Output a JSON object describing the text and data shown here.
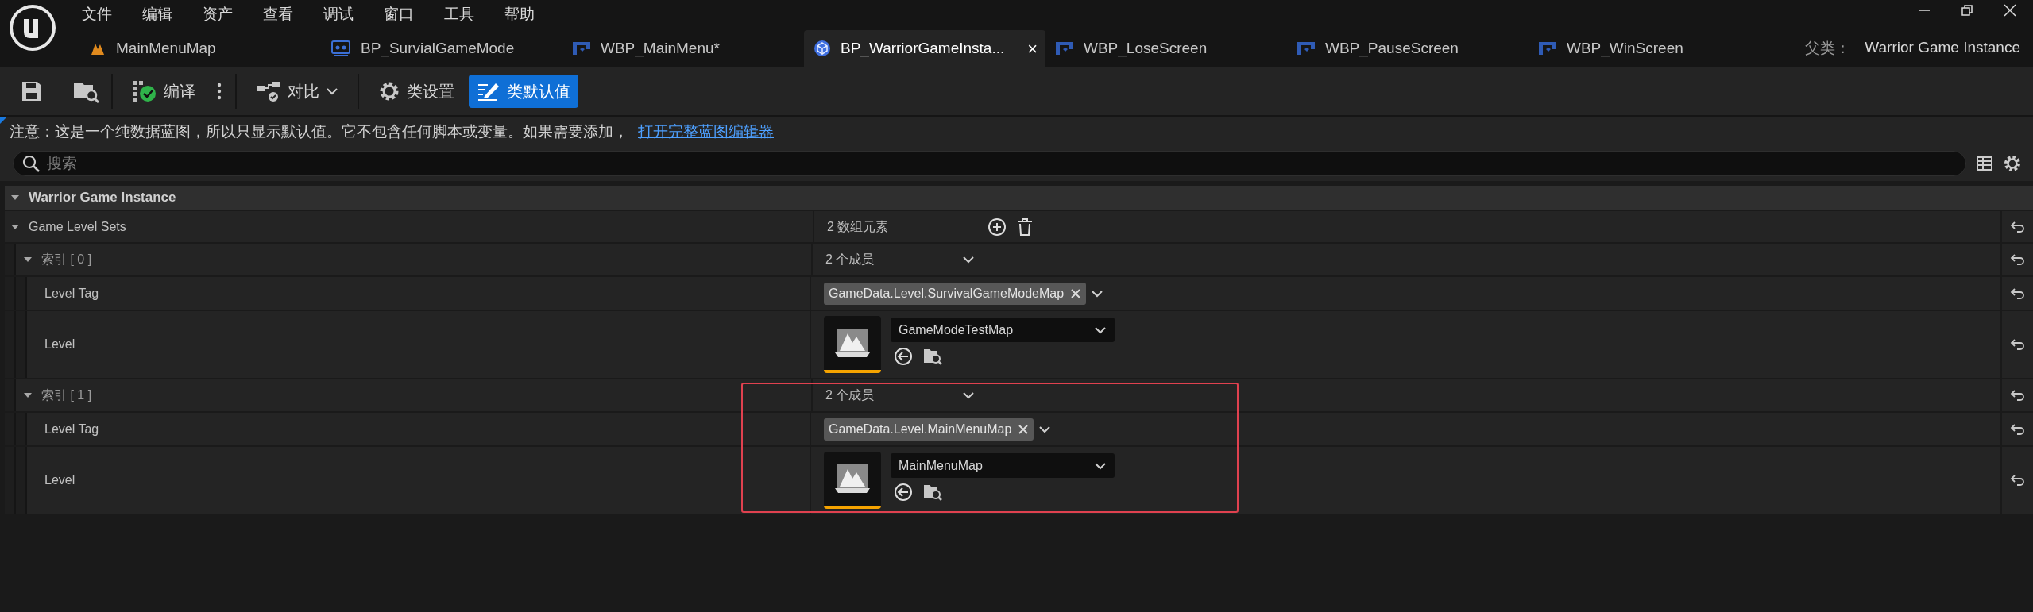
{
  "menu": [
    "文件",
    "编辑",
    "资产",
    "查看",
    "调试",
    "窗口",
    "工具",
    "帮助"
  ],
  "tabs": [
    {
      "label": "MainMenuMap",
      "kind": "level",
      "selected": false
    },
    {
      "label": "BP_SurvialGameMode",
      "kind": "gamemode",
      "selected": false
    },
    {
      "label": "WBP_MainMenu*",
      "kind": "widget",
      "selected": false
    },
    {
      "label": "BP_WarriorGameInsta...",
      "kind": "instance",
      "selected": true,
      "close": "×"
    },
    {
      "label": "WBP_LoseScreen",
      "kind": "widget",
      "selected": false
    },
    {
      "label": "WBP_PauseScreen",
      "kind": "widget",
      "selected": false
    },
    {
      "label": "WBP_WinScreen",
      "kind": "widget",
      "selected": false
    }
  ],
  "parent_class": {
    "label": "父类：",
    "value": "Warrior Game Instance"
  },
  "toolbar": [
    {
      "kind": "save"
    },
    {
      "kind": "browse"
    },
    {
      "kind": "compile",
      "label": "编译"
    },
    {
      "kind": "more"
    },
    {
      "kind": "diff",
      "label": "对比"
    },
    {
      "kind": "settings",
      "label": "类设置",
      "selected": false
    },
    {
      "kind": "defaults",
      "label": "类默认值",
      "selected": true
    }
  ],
  "notice": {
    "text": "注意：这是一个纯数据蓝图，所以只显示默认值。它不包含任何脚本或变量。如果需要添加，",
    "link": "打开完整蓝图编辑器"
  },
  "search": {
    "placeholder": "搜索"
  },
  "category": {
    "label": "Warrior Game Instance",
    "expanded": true
  },
  "property": {
    "label": "Game Level Sets",
    "value": "2 数组元素",
    "expanded": true,
    "elements": [
      {
        "label": "索引 [ 0 ]",
        "value": "2 个成员",
        "expanded": true,
        "highlighted": false,
        "fields": [
          {
            "kind": "tag",
            "label": "Level Tag",
            "value": "GameData.Level.SurvivalGameModeMap"
          },
          {
            "kind": "asset",
            "label": "Level",
            "value": "GameModeTestMap"
          }
        ]
      },
      {
        "label": "索引 [ 1 ]",
        "value": "2 个成员",
        "expanded": true,
        "highlighted": true,
        "fields": [
          {
            "kind": "tag",
            "label": "Level Tag",
            "value": "GameData.Level.MainMenuMap"
          },
          {
            "kind": "asset",
            "label": "Level",
            "value": "MainMenuMap"
          }
        ]
      }
    ]
  }
}
